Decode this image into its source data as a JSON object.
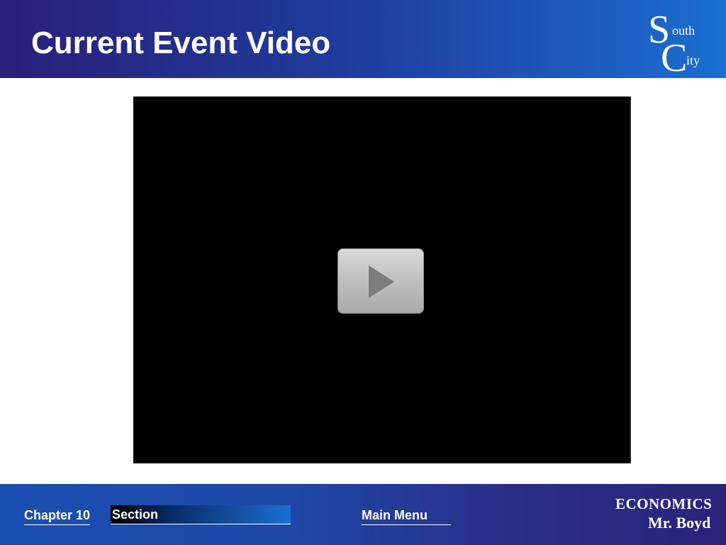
{
  "header": {
    "title": "Current Event Video",
    "logo": {
      "s_big": "S",
      "s_small": "outh",
      "c_big": "C",
      "c_small": "ity"
    }
  },
  "video": {
    "play_icon": "play-icon"
  },
  "footer": {
    "chapter_label": "Chapter 10",
    "section_label": "Section",
    "main_menu_label": "Main Menu",
    "brand_line1": "ECONOMICS",
    "brand_line2": "Mr. Boyd"
  },
  "colors": {
    "header_start": "#2a1f7a",
    "header_end": "#1a6fd0",
    "footer_start": "#1a4fb0",
    "footer_end": "#2a2479",
    "video_bg": "#000000",
    "play_button": "#bdbdbd"
  }
}
